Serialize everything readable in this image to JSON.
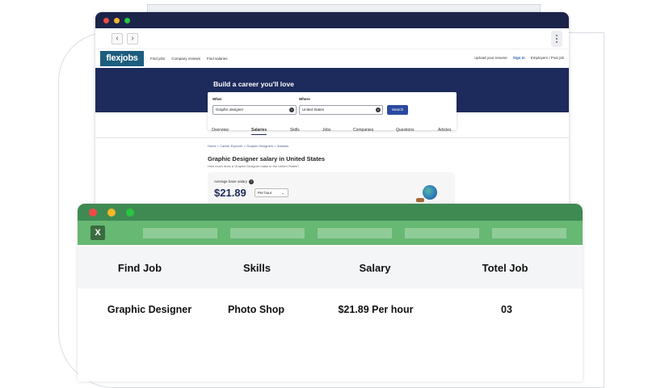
{
  "colors": {
    "browser_titlebar": "#1d2449",
    "hero": "#1d2b5c",
    "sheet_titlebar": "#3f8a53",
    "sheet_toolbar": "#66b872",
    "dot_red": "#ee4b45",
    "dot_yellow": "#f5b629",
    "dot_green": "#28c641"
  },
  "browser": {
    "nav": {
      "back": "‹",
      "forward": "›"
    },
    "site": {
      "logo": "flexjobs",
      "links": [
        "Find jobs",
        "Company reviews",
        "Find salaries"
      ],
      "right_links": [
        "Upload your resume",
        "Sign in",
        "Employers / Post job"
      ]
    },
    "hero_title": "Build a career you'll love",
    "search": {
      "what_label": "What",
      "what_value": "Graphic designer",
      "where_label": "Where",
      "where_value": "United States",
      "button": "Search"
    },
    "tabs": [
      "Overview",
      "Salaries",
      "Skills",
      "Jobs",
      "Companies",
      "Questions",
      "Articles"
    ],
    "breadcrumb": "Home > Career Explorer > Graphic Designers > Salaries",
    "page_title": "Graphic Designer salary in United States",
    "subtitle": "How much does a Graphic Designer make in the United States?",
    "salary": {
      "label": "Average base salary",
      "value": "$21.89",
      "period": "Per hour"
    }
  },
  "sheet": {
    "app_icon": "X",
    "headers": [
      "Find Job",
      "Skills",
      "Salary",
      "Totel Job"
    ],
    "row": [
      "Graphic Designer",
      "Photo Shop",
      "$21.89 Per hour",
      "03"
    ]
  }
}
